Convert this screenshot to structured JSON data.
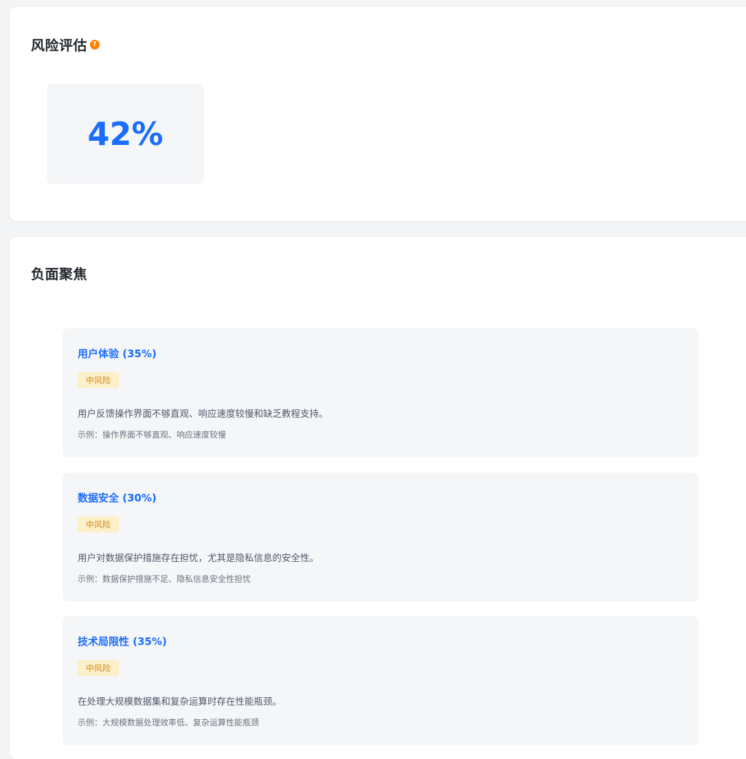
{
  "risk": {
    "title": "风险评估",
    "info_icon_glyph": "?",
    "value": "42%"
  },
  "negative_focus": {
    "title": "负面聚焦",
    "issues": [
      {
        "title": "用户体验 (35%)",
        "badge": "中风险",
        "description": "用户反馈操作界面不够直观、响应速度较慢和缺乏教程支持。",
        "example": "示例：操作界面不够直观、响应速度较慢"
      },
      {
        "title": "数据安全 (30%)",
        "badge": "中风险",
        "description": "用户对数据保护措施存在担忧，尤其是隐私信息的安全性。",
        "example": "示例：数据保护措施不足、隐私信息安全性担忧"
      },
      {
        "title": "技术局限性 (35%)",
        "badge": "中风险",
        "description": "在处理大规模数据集和复杂运算时存在性能瓶颈。",
        "example": "示例：大规模数据处理效率低、复杂运算性能瓶颈"
      }
    ]
  },
  "colors": {
    "accent": "#1a6dff",
    "badge_bg": "#fdefc8",
    "badge_text": "#d4891a",
    "info_icon": "#ff7d00"
  }
}
